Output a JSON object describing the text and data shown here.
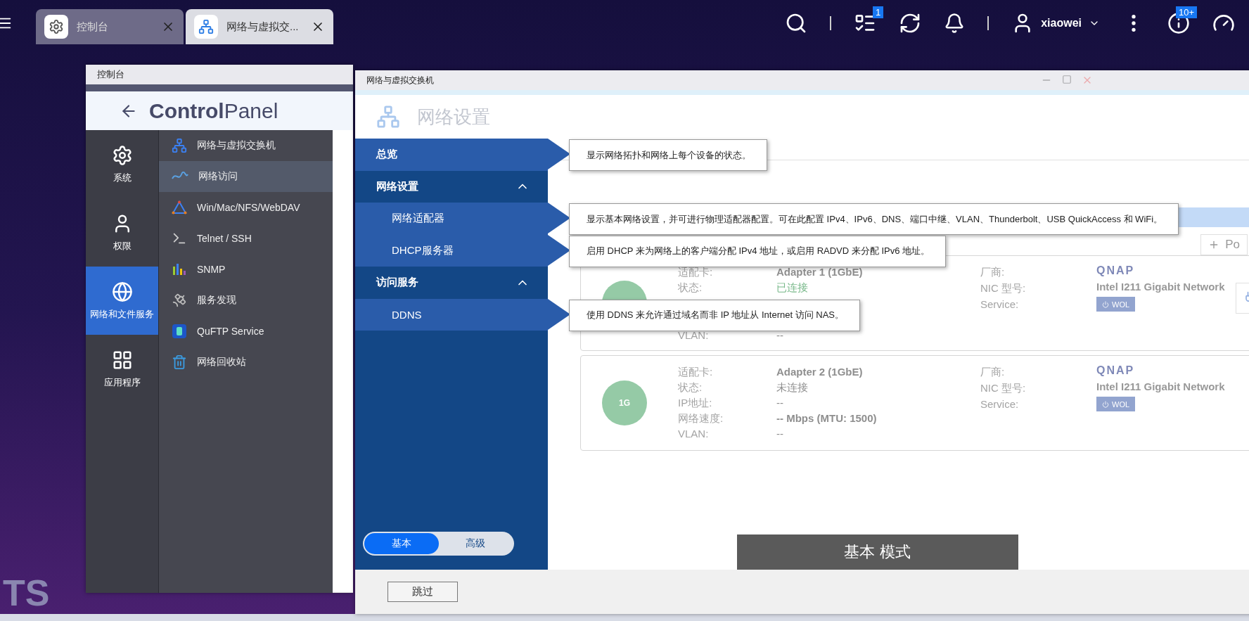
{
  "top_bar": {
    "tabs": [
      {
        "label": "控制台",
        "selected": false
      },
      {
        "label": "网络与虚拟交...",
        "selected": true
      }
    ],
    "task_badge": "1",
    "user": "xiaowei",
    "info_badge": "10+"
  },
  "desktop_text": "TS",
  "control_panel": {
    "title": "控制台",
    "heading": "**Control**Panel",
    "rail": [
      {
        "label": "系统",
        "selected": false
      },
      {
        "label": "权限",
        "selected": false
      },
      {
        "label": "网络和文件服务",
        "selected": true
      },
      {
        "label": "应用程序",
        "selected": false
      }
    ],
    "menu": [
      {
        "label": "网络与虚拟交换机",
        "selected": false
      },
      {
        "label": "网络访问",
        "selected": true
      },
      {
        "label": "Win/Mac/NFS/WebDAV",
        "selected": false
      },
      {
        "label": "Telnet / SSH",
        "selected": false
      },
      {
        "label": "SNMP",
        "selected": false
      },
      {
        "label": "服务发现",
        "selected": false
      },
      {
        "label": "QuFTP Service",
        "selected": false
      },
      {
        "label": "网络回收站",
        "selected": false
      }
    ]
  },
  "network_window": {
    "title": "网络与虚拟交换机",
    "heading": "网络设置",
    "nav": [
      {
        "label": "总览",
        "kind": "item",
        "tooltip": "显示网络拓扑和网络上每个设备的状态。"
      },
      {
        "label": "网络设置",
        "kind": "section",
        "expanded": true
      },
      {
        "label": "网络适配器",
        "kind": "subitem",
        "tooltip": "显示基本网络设置，并可进行物理适配器配置。可在此配置 IPv4、IPv6、DNS、端口中继、VLAN、Thunderbolt、USB QuickAccess 和 WiFi。"
      },
      {
        "label": "DHCP服务器",
        "kind": "subitem",
        "tooltip": "启用 DHCP 来为网络上的客户端分配 IPv4 地址，或启用 RADVD 来分配 IPv6 地址。"
      },
      {
        "label": "访问服务",
        "kind": "section",
        "expanded": true
      },
      {
        "label": "DDNS",
        "kind": "subitem",
        "tooltip": "使用 DDNS 来允许通过域名而非 IP 地址从 Internet 访问 NAS。"
      }
    ],
    "add_button": "Po",
    "cards": [
      {
        "connected": true,
        "fields": [
          {
            "label": "适配卡:",
            "value": "Adapter 1 (1GbE)",
            "kind": "title"
          },
          {
            "label": "状态:",
            "value": "已连接",
            "kind": "status"
          },
          {
            "label": "VLAN:",
            "value": "--",
            "kind": "after-gap"
          }
        ],
        "vendor": {
          "label": "厂商:",
          "logo": "QNAP"
        },
        "model": {
          "label": "NIC 型号:",
          "value": "Intel I211 Gigabit Network"
        },
        "service": {
          "label": "Service:",
          "badge": "WOL"
        },
        "side_button": true
      },
      {
        "icon_text": "1G",
        "connected": false,
        "fields": [
          {
            "label": "适配卡:",
            "value": "Adapter 2 (1GbE)",
            "kind": "title"
          },
          {
            "label": "状态:",
            "value": "未连接",
            "kind": "status"
          },
          {
            "label": "IP地址:",
            "value": "--",
            "kind": "plain"
          },
          {
            "label": "网络速度:",
            "value": "-- Mbps (MTU: 1500)",
            "kind": "title"
          },
          {
            "label": "VLAN:",
            "value": "--",
            "kind": "plain"
          }
        ],
        "vendor": {
          "label": "厂商:",
          "logo": "QNAP"
        },
        "model": {
          "label": "NIC 型号:",
          "value": "Intel I211 Gigabit Network"
        },
        "service": {
          "label": "Service:",
          "badge": "WOL"
        },
        "side_button": false
      }
    ],
    "mode_toggle": [
      {
        "label": "基本",
        "selected": true
      },
      {
        "label": "高级",
        "selected": false
      }
    ],
    "mode_banner": "基本 模式",
    "skip_button": "跳过"
  }
}
